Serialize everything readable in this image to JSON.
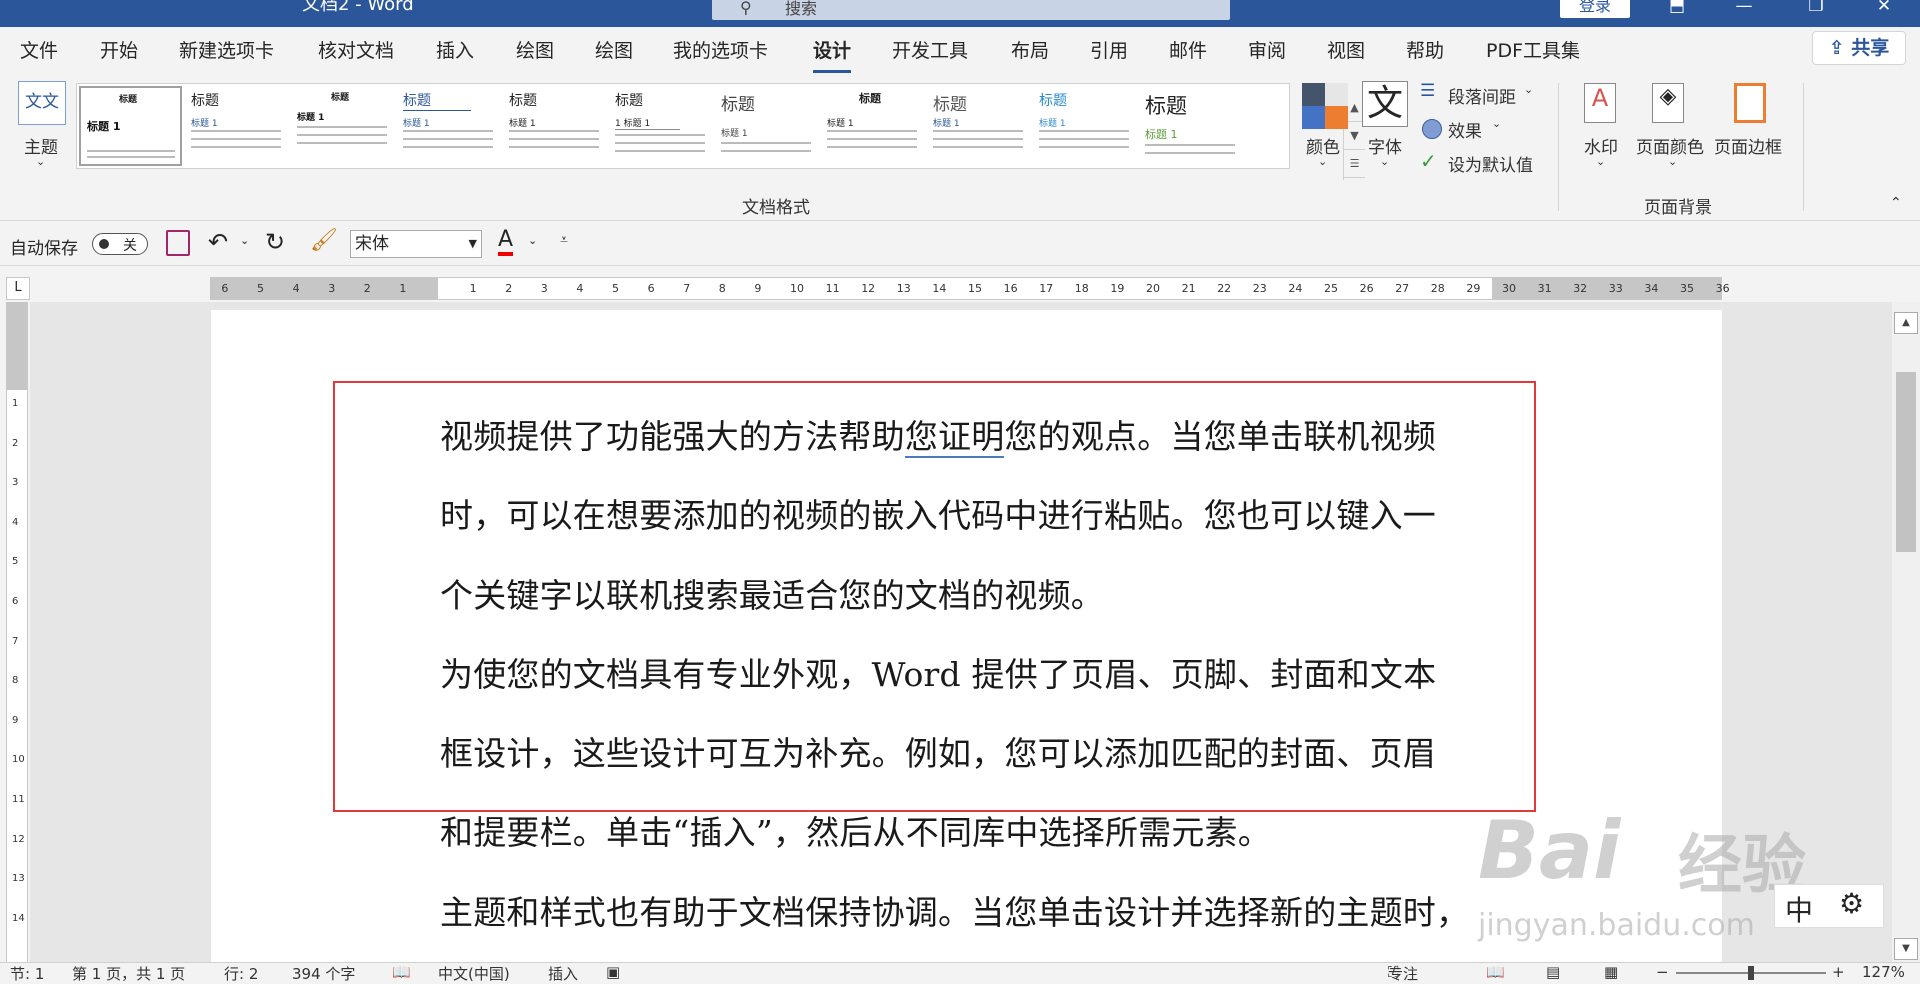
{
  "window": {
    "title": "文档2 - Word",
    "search_placeholder": "搜索",
    "login": "登录",
    "min_icon": "—",
    "restore_icon": "❐",
    "close_icon": "✕",
    "ribbon_display_icon": "⬒"
  },
  "tabs": [
    "文件",
    "开始",
    "新建选项卡",
    "核对文档",
    "插入",
    "绘图",
    "绘图",
    "我的选项卡",
    "设计",
    "开发工具",
    "布局",
    "引用",
    "邮件",
    "审阅",
    "视图",
    "帮助",
    "PDF工具集"
  ],
  "active_tab": "设计",
  "share": "共享",
  "ribbon": {
    "theme": {
      "label": "主题",
      "icon_text": "文文"
    },
    "gallery_items": [
      {
        "title": "标题",
        "heading": "标题 1"
      },
      {
        "title": "标题",
        "heading": "标题 1"
      },
      {
        "title": "标题",
        "heading": "标题 1"
      },
      {
        "title": "标题",
        "heading": "标题 1"
      },
      {
        "title": "标题",
        "heading": "标题 1"
      },
      {
        "title": "标题",
        "heading": "1 标题 1"
      },
      {
        "title": "标题",
        "heading": "标题 1"
      },
      {
        "title": "标题",
        "heading": "标题 1"
      },
      {
        "title": "标题",
        "heading": "标题 1"
      },
      {
        "title": "标题",
        "heading": "标题 1"
      },
      {
        "title": "标题",
        "heading": "标题 1"
      }
    ],
    "group_doc_format": "文档格式",
    "colors": "颜色",
    "fonts": {
      "label": "字体",
      "icon_text": "文"
    },
    "para_spacing": "段落间距",
    "effects": "效果",
    "set_default": "设为默认值",
    "watermark": "水印",
    "page_color": "页面颜色",
    "page_border": "页面边框",
    "group_page_bg": "页面背景",
    "collapse_icon": "⌃"
  },
  "qat": {
    "autosave": "自动保存",
    "toggle": "关",
    "font": "宋体",
    "font_color_letter": "A"
  },
  "ruler": {
    "h_left": [
      "6",
      "5",
      "4",
      "3",
      "2",
      "1"
    ],
    "h_right": [
      "1",
      "2",
      "3",
      "4",
      "5",
      "6",
      "7",
      "8",
      "9",
      "10",
      "11",
      "12",
      "13",
      "14",
      "15",
      "16",
      "17",
      "18",
      "19",
      "20",
      "21",
      "22",
      "23",
      "24",
      "25",
      "26",
      "27",
      "28",
      "29",
      "30",
      "31",
      "32",
      "33",
      "34",
      "35",
      "36"
    ],
    "v": [
      "1",
      "2",
      "3",
      "4",
      "5",
      "6",
      "7",
      "8",
      "9",
      "10",
      "11",
      "12",
      "13",
      "14"
    ],
    "tab_marker": "L"
  },
  "document": {
    "p1_l1_a": "视频提供了功能强大的方法帮助",
    "p1_l1_ul": "您证明",
    "p1_l1_b": "您的观点。当您单击联机视频",
    "p1_l2": "时，可以在想要添加的视频的嵌入代码中进行粘贴。您也可以键入一",
    "p1_l3": "个关键字以联机搜索最适合您的文档的视频。",
    "p2_l1": "为使您的文档具有专业外观，Word 提供了页眉、页脚、封面和文本",
    "p2_l2": "框设计，这些设计可互为补充。例如，您可以添加匹配的封面、页眉",
    "p2_l3": "和提要栏。单击“插入”，然后从不同库中选择所需元素。",
    "p3_l1": "主题和样式也有助于文档保持协调。当您单击设计并选择新的主题时，"
  },
  "watermark": {
    "brand": "Bai",
    "brand2": "经验",
    "url": "jingyan.baidu.com"
  },
  "ime": {
    "mode": "中",
    "gear": "⚙"
  },
  "status": {
    "section": "节: 1",
    "page": "第 1 页，共 1 页",
    "line": "行: 2",
    "chars": "394 个字",
    "lang": "中文(中国)",
    "insert": "插入",
    "focus": "专注",
    "zoom": "127%",
    "minus": "−",
    "plus": "+"
  }
}
